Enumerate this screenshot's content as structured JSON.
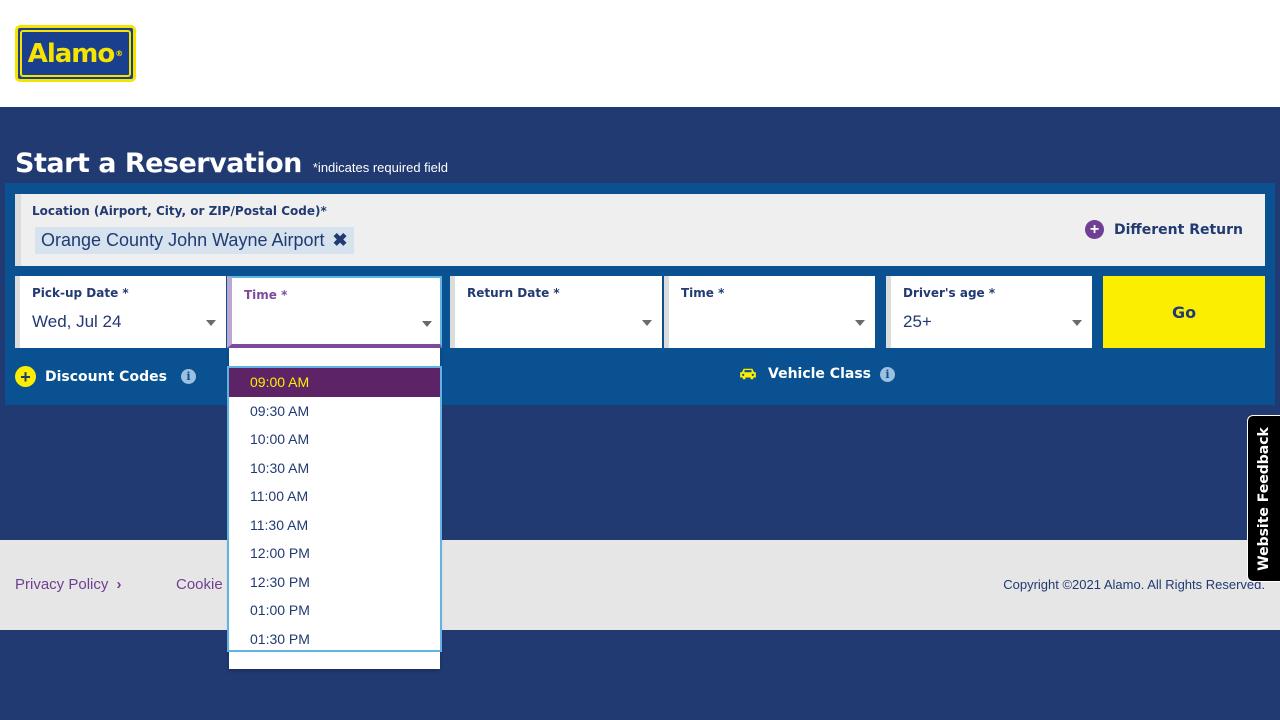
{
  "header": {
    "logo_text": "Alamo"
  },
  "reservation": {
    "title": "Start a Reservation",
    "required_note": "*indicates required field",
    "location": {
      "label": "Location (Airport, City, or ZIP/Postal Code)*",
      "value": "Orange County John Wayne Airport",
      "remove_glyph": "✖"
    },
    "different_return": "Different Return",
    "pickup_date": {
      "label": "Pick-up Date *",
      "value": "Wed, Jul 24"
    },
    "pickup_time": {
      "label": "Time *",
      "value": ""
    },
    "return_date": {
      "label": "Return Date *",
      "value": ""
    },
    "return_time": {
      "label": "Time *",
      "value": ""
    },
    "drivers_age": {
      "label": "Driver's age *",
      "value": "25+"
    },
    "go_label": "Go",
    "discount_codes": "Discount Codes",
    "vehicle_class": "Vehicle Class",
    "info_glyph": "i"
  },
  "time_dropdown": {
    "selected": "09:00 AM",
    "options": [
      "09:00 AM",
      "09:30 AM",
      "10:00 AM",
      "10:30 AM",
      "11:00 AM",
      "11:30 AM",
      "12:00 PM",
      "12:30 PM",
      "01:00 PM",
      "01:30 PM"
    ]
  },
  "footer": {
    "privacy": "Privacy Policy",
    "cookie": "Cookie",
    "copyright": "Copyright ©2021 Alamo. All Rights Reserved."
  },
  "feedback_tab": "Website Feedback",
  "colors": {
    "navy": "#213a72",
    "panel_blue": "#0a5192",
    "yellow": "#fcee00",
    "purple": "#5c2466"
  }
}
